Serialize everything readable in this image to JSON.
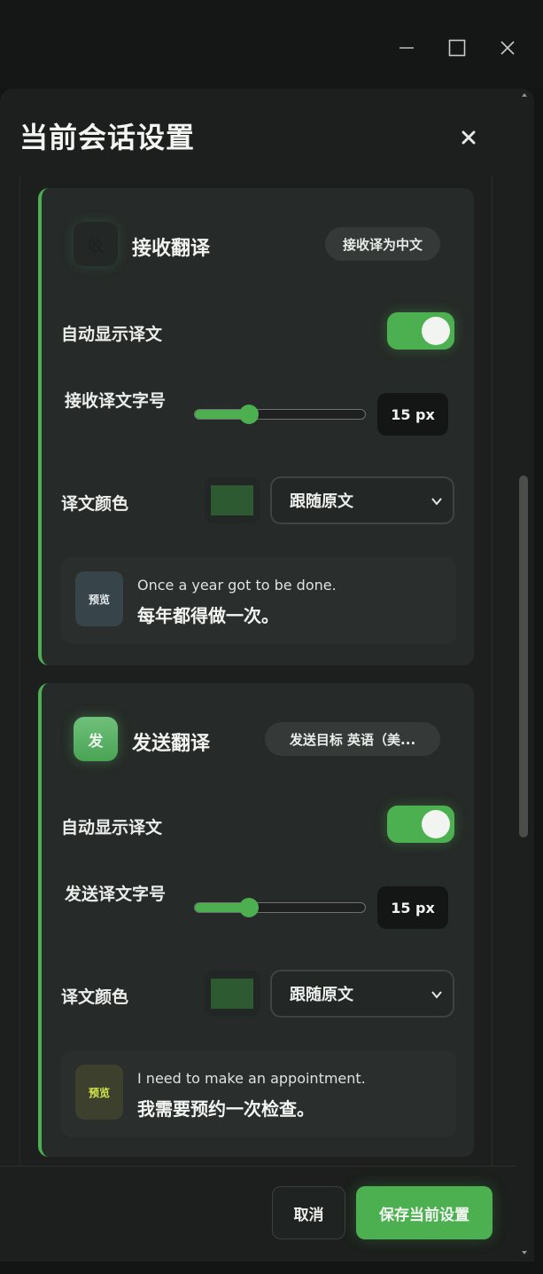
{
  "dialog": {
    "title": "当前会话设置"
  },
  "receive": {
    "icon_char": "收",
    "title": "接收翻译",
    "badge": "接收译为中文",
    "auto_show_label": "自动显示译文",
    "auto_show_on": true,
    "font_size_label": "接收译文字号",
    "font_size_value": "15 px",
    "font_size_slider_fraction": 0.32,
    "color_label": "译文颜色",
    "color_swatch": "#2e5a32",
    "color_select": "跟随原文",
    "preview_tag": "预览",
    "preview_source": "Once a year got to be done.",
    "preview_translation": "每年都得做一次。"
  },
  "send": {
    "icon_char": "发",
    "title": "发送翻译",
    "badge": "发送目标 英语（美...",
    "auto_show_label": "自动显示译文",
    "auto_show_on": true,
    "font_size_label": "发送译文字号",
    "font_size_value": "15 px",
    "font_size_slider_fraction": 0.32,
    "color_label": "译文颜色",
    "color_swatch": "#2e5a32",
    "color_select": "跟随原文",
    "preview_tag": "预览",
    "preview_source": "I need to make an appointment.",
    "preview_translation": "我需要预约一次检查。"
  },
  "footer": {
    "cancel_label": "取消",
    "save_label": "保存当前设置"
  },
  "colors": {
    "accent": "#4caf50",
    "background": "#1c1f1d",
    "card": "#262a28"
  },
  "icons": {
    "minimize": "minimize-icon",
    "maximize": "maximize-icon",
    "window_close": "close-icon",
    "dialog_close": "close-icon",
    "select": "chevron-down-icon"
  }
}
